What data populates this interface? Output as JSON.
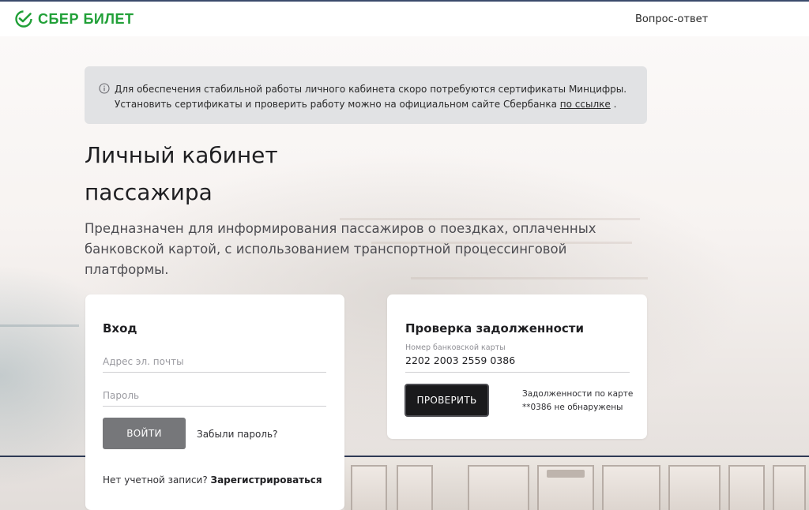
{
  "header": {
    "brand": "СБЕР БИЛЕТ",
    "faq_link": "Вопрос-ответ",
    "brand_color": "#21a038"
  },
  "notice": {
    "icon": "info-icon",
    "line1": "Для обеспечения стабильной работы личного кабинета скоро потребуются сертификаты Минцифры.",
    "line2_prefix": "Установить сертификаты и проверить работу можно на официальном сайте Сбербанка ",
    "link_text": "по ссылке",
    "line2_suffix": " ."
  },
  "page": {
    "title_line1": "Личный кабинет",
    "title_line2": "пассажира",
    "lead": "Предназначен для информирования пассажиров о поездках, оплаченных банковской картой, с использованием транспортной процессинговой платформы."
  },
  "login": {
    "title": "Вход",
    "email_placeholder": "Адрес эл. почты",
    "password_placeholder": "Пароль",
    "submit_label": "ВОЙТИ",
    "forgot_link": "Забыли пароль?",
    "no_account_text": "Нет учетной записи? ",
    "register_link": "Зарегистрироваться"
  },
  "debt_check": {
    "title": "Проверка задолженности",
    "card_label": "Номер банковской карты",
    "card_number": "2202 2003 2559 0386",
    "submit_label": "ПРОВЕРИТЬ",
    "result_line1": "Задолженности по карте",
    "result_line2": "**0386 не обнаружены"
  }
}
